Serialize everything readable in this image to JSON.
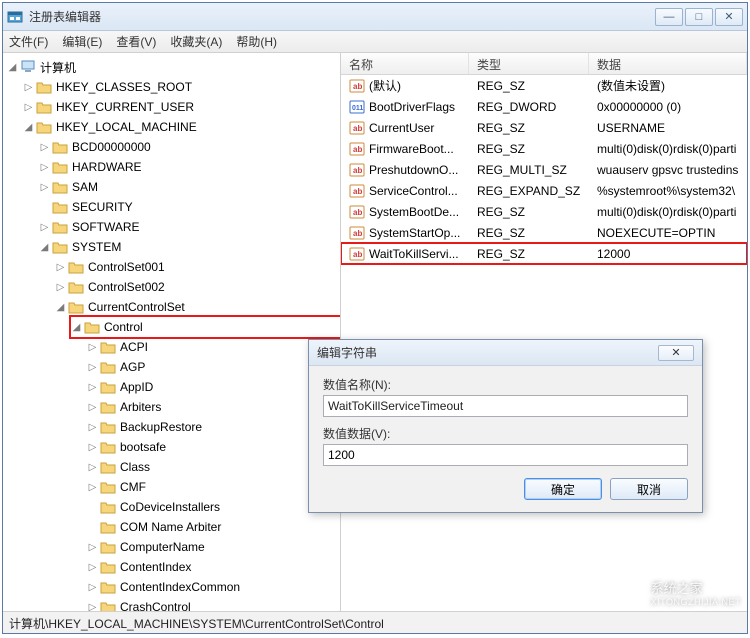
{
  "window": {
    "title": "注册表编辑器",
    "min": "—",
    "max": "□",
    "close": "✕"
  },
  "menu": {
    "file": "文件(F)",
    "edit": "编辑(E)",
    "view": "查看(V)",
    "favorites": "收藏夹(A)",
    "help": "帮助(H)"
  },
  "tree": {
    "root": "计算机",
    "hkcr": "HKEY_CLASSES_ROOT",
    "hkcu": "HKEY_CURRENT_USER",
    "hklm": "HKEY_LOCAL_MACHINE",
    "bcd": "BCD00000000",
    "hardware": "HARDWARE",
    "sam": "SAM",
    "security": "SECURITY",
    "software": "SOFTWARE",
    "system": "SYSTEM",
    "cs1": "ControlSet001",
    "cs2": "ControlSet002",
    "ccs": "CurrentControlSet",
    "control": "Control",
    "acpi": "ACPI",
    "agp": "AGP",
    "appid": "AppID",
    "arbiters": "Arbiters",
    "backup": "BackupRestore",
    "bootsafe": "bootsafe",
    "class": "Class",
    "cmf": "CMF",
    "codev": "CoDeviceInstallers",
    "comname": "COM Name Arbiter",
    "compname": "ComputerName",
    "contentindex": "ContentIndex",
    "contentcommon": "ContentIndexCommon",
    "crashcontrol": "CrashControl"
  },
  "list": {
    "headers": {
      "name": "名称",
      "type": "类型",
      "data": "数据"
    },
    "rows": [
      {
        "name": "(默认)",
        "type": "REG_SZ",
        "data": "(数值未设置)",
        "icon": "str"
      },
      {
        "name": "BootDriverFlags",
        "type": "REG_DWORD",
        "data": "0x00000000 (0)",
        "icon": "bin"
      },
      {
        "name": "CurrentUser",
        "type": "REG_SZ",
        "data": "USERNAME",
        "icon": "str"
      },
      {
        "name": "FirmwareBoot...",
        "type": "REG_SZ",
        "data": "multi(0)disk(0)rdisk(0)parti",
        "icon": "str"
      },
      {
        "name": "PreshutdownO...",
        "type": "REG_MULTI_SZ",
        "data": "wuauserv gpsvc trustedins",
        "icon": "str"
      },
      {
        "name": "ServiceControl...",
        "type": "REG_EXPAND_SZ",
        "data": "%systemroot%\\system32\\",
        "icon": "str"
      },
      {
        "name": "SystemBootDe...",
        "type": "REG_SZ",
        "data": "multi(0)disk(0)rdisk(0)parti",
        "icon": "str"
      },
      {
        "name": "SystemStartOp...",
        "type": "REG_SZ",
        "data": " NOEXECUTE=OPTIN",
        "icon": "str"
      },
      {
        "name": "WaitToKillServi...",
        "type": "REG_SZ",
        "data": "12000",
        "icon": "str",
        "highlight": true
      }
    ]
  },
  "dialog": {
    "title": "编辑字符串",
    "name_label": "数值名称(N):",
    "name_value": "WaitToKillServiceTimeout",
    "data_label": "数值数据(V):",
    "data_value": "1200",
    "ok": "确定",
    "cancel": "取消",
    "close": "✕"
  },
  "statusbar": "计算机\\HKEY_LOCAL_MACHINE\\SYSTEM\\CurrentControlSet\\Control",
  "watermark": {
    "line1": "系统之家",
    "line2": "XITONGZHIJIA.NET"
  }
}
